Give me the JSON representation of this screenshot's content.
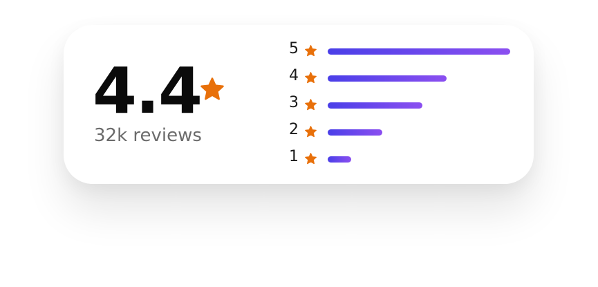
{
  "rating": {
    "score": "4.4",
    "reviews_label": "32k reviews",
    "star_color": "#E8700A",
    "bar_gradient": [
      "#4A3FE8",
      "#8B4FF0"
    ]
  },
  "distribution": [
    {
      "stars": "5",
      "fill": 1.0
    },
    {
      "stars": "4",
      "fill": 0.65
    },
    {
      "stars": "3",
      "fill": 0.52
    },
    {
      "stars": "2",
      "fill": 0.3
    },
    {
      "stars": "1",
      "fill": 0.13
    }
  ]
}
